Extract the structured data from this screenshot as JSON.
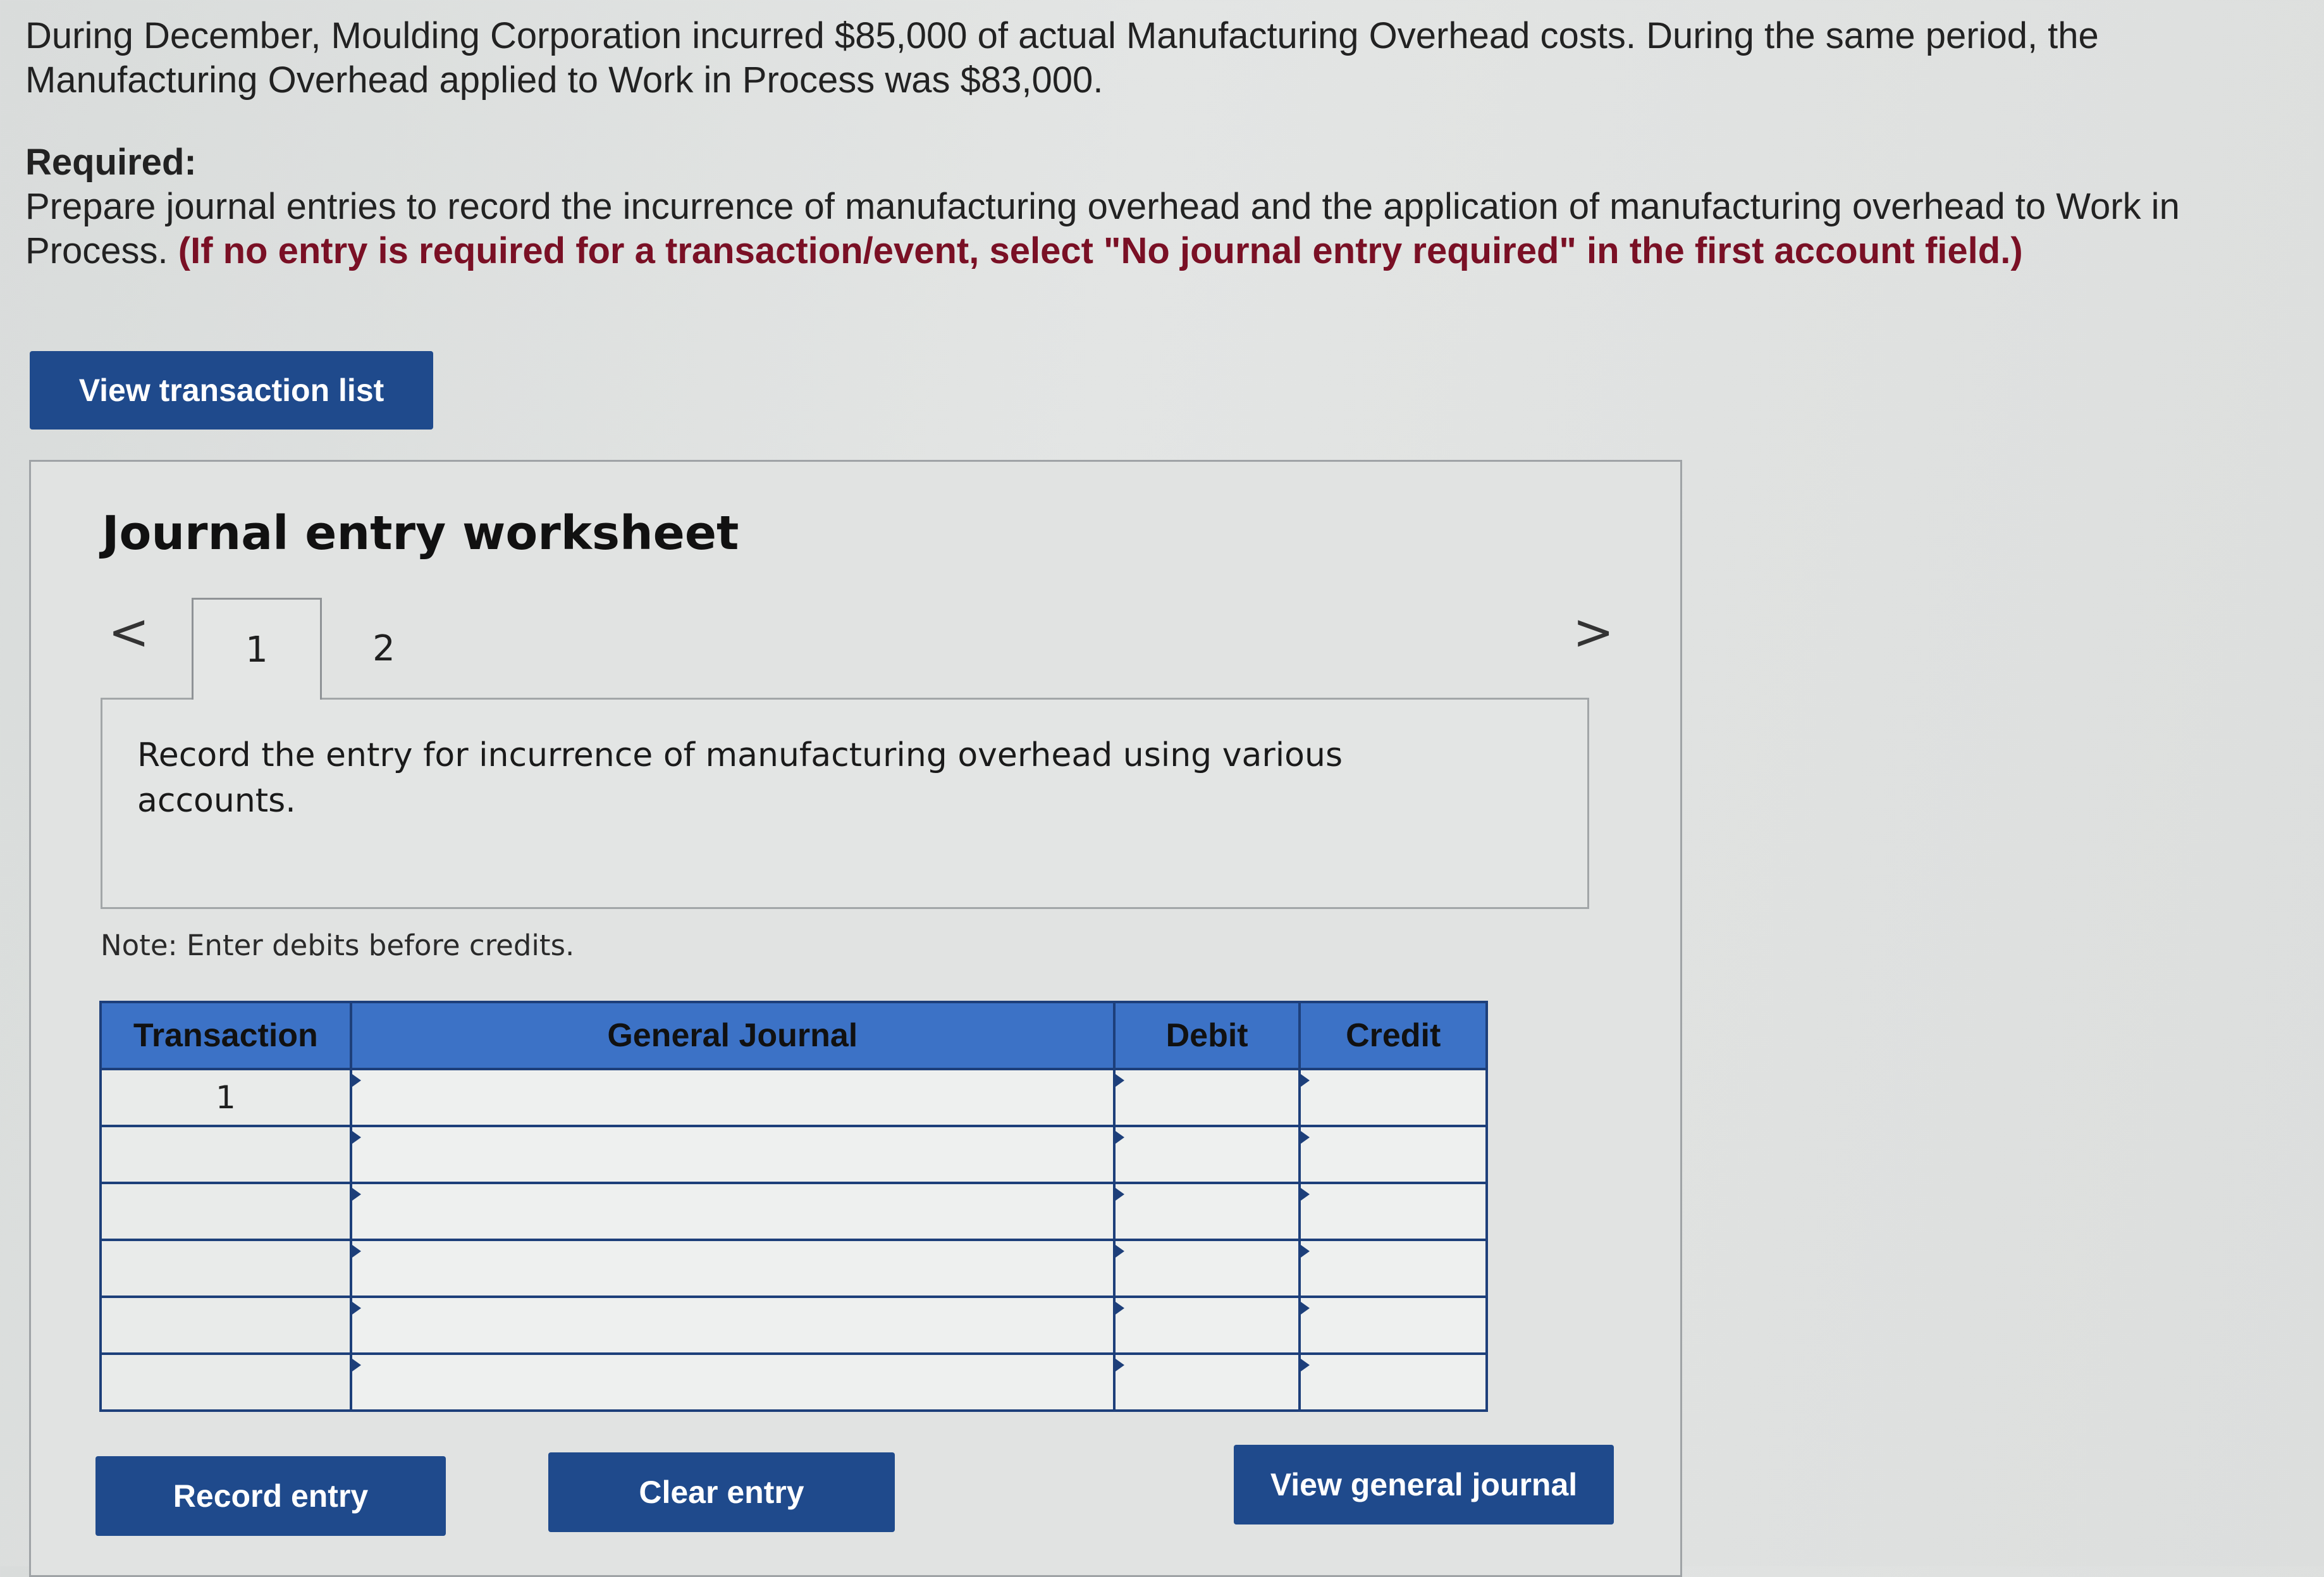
{
  "problem": {
    "text": "During December, Moulding Corporation incurred $85,000 of actual Manufacturing Overhead costs. During the same period, the Manufacturing Overhead applied to Work in Process was $83,000.",
    "required_label": "Required:",
    "required_text": "Prepare journal entries to record the incurrence of manufacturing overhead and the application of manufacturing overhead to Work in Process.",
    "required_instruction": "(If no entry is required for a transaction/event, select \"No journal entry required\" in the first account field.)"
  },
  "buttons": {
    "view_transaction_list": "View transaction list",
    "record_entry": "Record entry",
    "clear_entry": "Clear entry",
    "view_general_journal": "View general journal"
  },
  "worksheet": {
    "title": "Journal entry worksheet",
    "prev_icon": "<",
    "next_icon": ">",
    "tabs": [
      {
        "label": "1"
      },
      {
        "label": "2"
      }
    ],
    "active_tab": "1",
    "instruction": "Record the entry for incurrence of manufacturing overhead using various accounts.",
    "note": "Note: Enter debits before credits."
  },
  "table": {
    "headers": {
      "transaction": "Transaction",
      "general_journal": "General Journal",
      "debit": "Debit",
      "credit": "Credit"
    },
    "rows": [
      {
        "transaction": "1",
        "account": "",
        "debit": "",
        "credit": ""
      },
      {
        "transaction": "",
        "account": "",
        "debit": "",
        "credit": ""
      },
      {
        "transaction": "",
        "account": "",
        "debit": "",
        "credit": ""
      },
      {
        "transaction": "",
        "account": "",
        "debit": "",
        "credit": ""
      },
      {
        "transaction": "",
        "account": "",
        "debit": "",
        "credit": ""
      },
      {
        "transaction": "",
        "account": "",
        "debit": "",
        "credit": ""
      }
    ]
  },
  "colors": {
    "primary_button": "#1f4a8c",
    "table_header": "#3c72c6",
    "instruction_red": "#7a1025"
  }
}
